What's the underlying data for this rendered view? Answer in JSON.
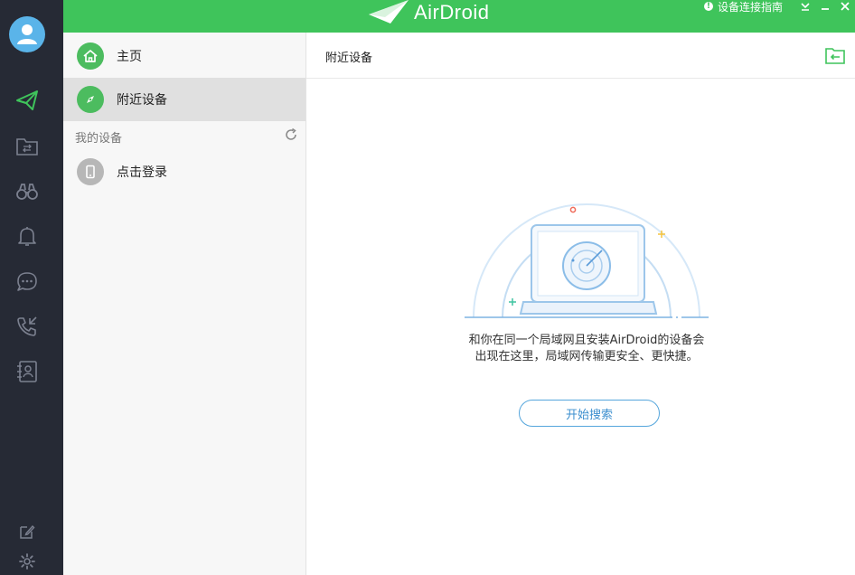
{
  "app": {
    "brand_name": "AirDroid"
  },
  "topbar": {
    "guide_label": "设备连接指南"
  },
  "panel": {
    "nav": [
      {
        "label": "主页",
        "icon": "home-icon",
        "color": "#4cbc5f"
      },
      {
        "label": "附近设备",
        "icon": "compass-icon",
        "color": "#4cbc5f"
      }
    ],
    "section_label": "我的设备",
    "login_item": {
      "label": "点击登录",
      "icon": "phone-icon",
      "color": "#b7b7b7"
    }
  },
  "content": {
    "title": "附近设备",
    "description_line1": "和你在同一个局域网且安装AirDroid的设备会",
    "description_line2": "出现在这里，局域网传输更安全、更快捷。",
    "search_button": "开始搜索"
  },
  "colors": {
    "accent_green": "#3fc45b",
    "sidebar_dark": "#262a35",
    "button_blue": "#3c8fcf"
  }
}
